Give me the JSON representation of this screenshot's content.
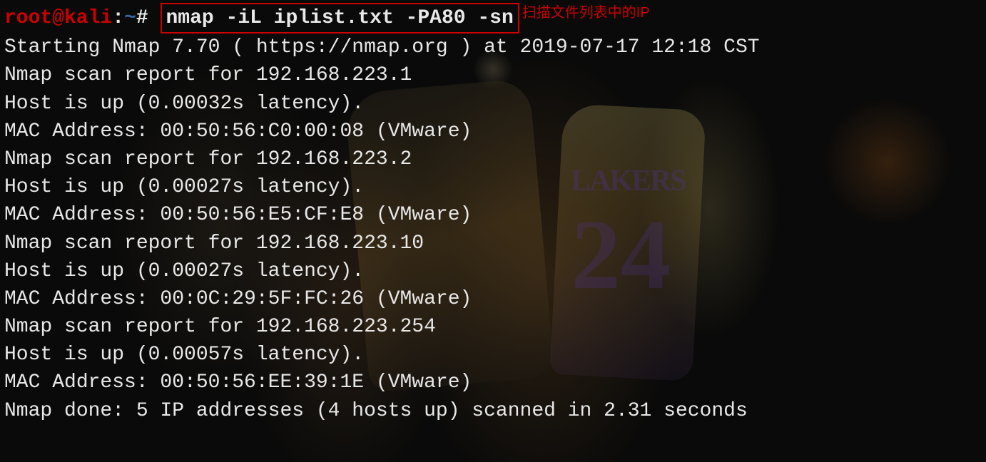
{
  "prompt": {
    "user": "root",
    "at": "@",
    "host": "kali",
    "sep": ":",
    "path": "~",
    "hash": "#"
  },
  "command": "nmap -iL iplist.txt -PA80 -sn",
  "annotation": "扫描文件列表中的IP",
  "output": {
    "line1": "Starting Nmap 7.70 ( https://nmap.org ) at 2019-07-17 12:18 CST",
    "line2": "Nmap scan report for 192.168.223.1",
    "line3": "Host is up (0.00032s latency).",
    "line4": "MAC Address: 00:50:56:C0:00:08 (VMware)",
    "line5": "Nmap scan report for 192.168.223.2",
    "line6": "Host is up (0.00027s latency).",
    "line7": "MAC Address: 00:50:56:E5:CF:E8 (VMware)",
    "line8": "Nmap scan report for 192.168.223.10",
    "line9": "Host is up (0.00027s latency).",
    "line10": "MAC Address: 00:0C:29:5F:FC:26 (VMware)",
    "line11": "Nmap scan report for 192.168.223.254",
    "line12": "Host is up (0.00057s latency).",
    "line13": "MAC Address: 00:50:56:EE:39:1E (VMware)",
    "line14": "Nmap done: 5 IP addresses (4 hosts up) scanned in 2.31 seconds"
  }
}
